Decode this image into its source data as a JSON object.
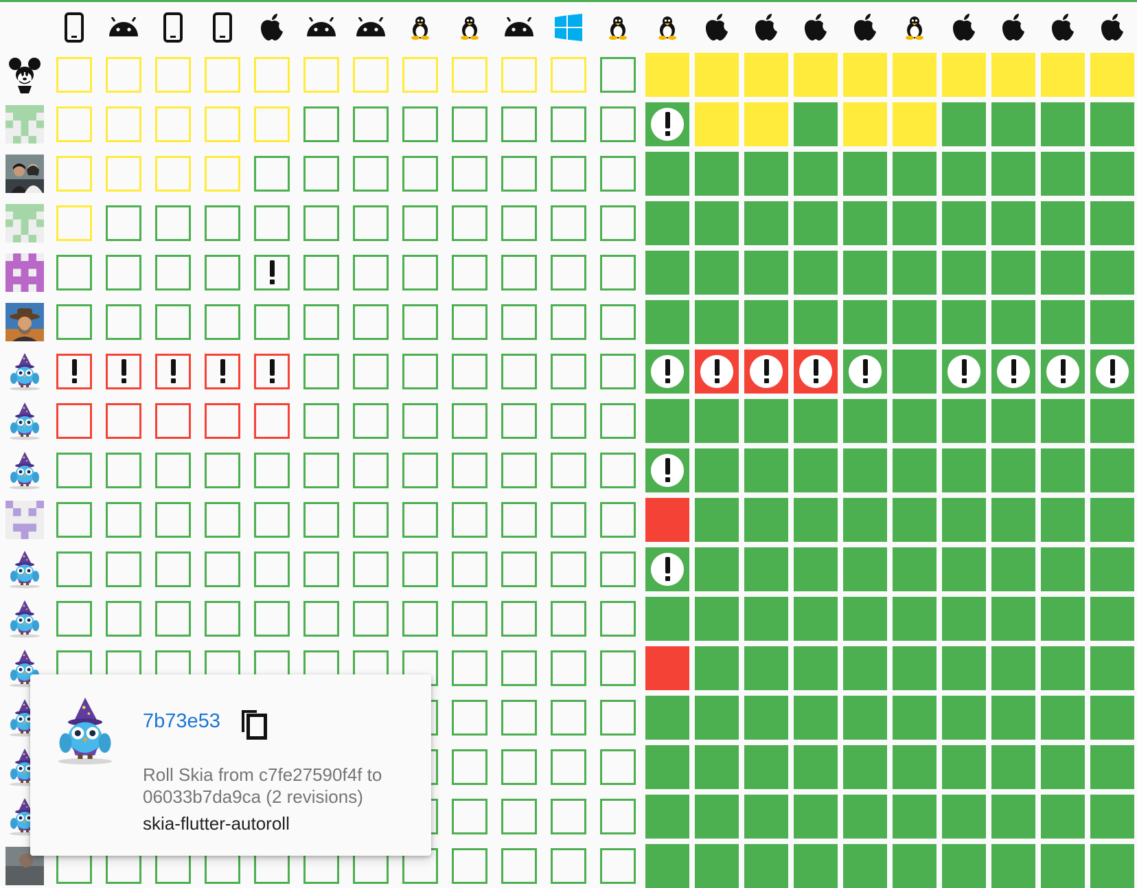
{
  "platforms": [
    "ios",
    "android",
    "ios",
    "ios",
    "mac",
    "android",
    "android",
    "linux",
    "linux",
    "android",
    "windows",
    "linux",
    "linux",
    "mac",
    "mac",
    "mac",
    "mac",
    "linux",
    "mac",
    "mac",
    "mac",
    "mac"
  ],
  "colors": {
    "yellow": "#ffeb3b",
    "green": "#4caf50",
    "red": "#f44336",
    "link": "#1976d2"
  },
  "cell_codes": {
    "Y": "outlined yellow",
    "G": "outlined green",
    "R": "outlined red",
    "E": "outlined red with exclamation",
    "W": "outlined green with exclamation",
    "F": "filled yellow",
    "Q": "filled green",
    "X": "filled red",
    "I": "filled green with exclamation",
    "J": "filled red with exclamation"
  },
  "commits": [
    {
      "avatar": "mickey-mouse-avatar",
      "cells": "YYYYYYYYYYYGFFFFFFFFFF"
    },
    {
      "avatar": "identicon-green-avatar",
      "cells": "YYYYYGGGGGGGIFFQFFQQQQ"
    },
    {
      "avatar": "photo-couple-avatar",
      "cells": "YYYYGGGGGGGGQQQQQQQQQQ"
    },
    {
      "avatar": "identicon-green-avatar",
      "cells": "YGGGGGGGGGGGQQQQQQQQQQ"
    },
    {
      "avatar": "identicon-purple-avatar",
      "cells": "GGGGWGGGGGGGQQQQQQQQQQ"
    },
    {
      "avatar": "photo-hat-avatar",
      "cells": "GGGGGGGGGGGGQQQQQQQQQQ"
    },
    {
      "avatar": "wizard-owl-avatar",
      "cells": "EEEEEGGGGGGGIJJJIQIIII"
    },
    {
      "avatar": "wizard-owl-avatar",
      "cells": "RRRRRGGGGGGGQQQQQQQQQQ"
    },
    {
      "avatar": "wizard-owl-avatar",
      "cells": "GGGGGGGGGGGGIQQQQQQQQQ"
    },
    {
      "avatar": "identicon-lavender-avatar",
      "cells": "GGGGGGGGGGGGXQQQQQQQQQ"
    },
    {
      "avatar": "wizard-owl-avatar",
      "cells": "GGGGGGGGGGGGIQQQQQQQQQ"
    },
    {
      "avatar": "wizard-owl-avatar",
      "cells": "GGGGGGGGGGGGQQQQQQQQQQ"
    },
    {
      "avatar": "wizard-owl-avatar",
      "cells": "GGGGGGGGGGGGXQQQQQQQQQ"
    },
    {
      "avatar": "wizard-owl-avatar",
      "cells": "GGGGGGGGGGGGQQQQQQQQQQ"
    },
    {
      "avatar": "wizard-owl-avatar",
      "cells": "GGGGGGGGGGGGQQQQQQQQQQ"
    },
    {
      "avatar": "wizard-owl-avatar",
      "cells": "GGGGGGGGGGGGQQQQQQQQQQ"
    },
    {
      "avatar": "photo-partial-avatar",
      "cells": "GGGGGGGGGGGGQQQQQQQQQQ"
    }
  ],
  "tooltip": {
    "sha": "7b73e53",
    "message": "Roll Skia from c7fe27590f4f to 06033b7da9ca (2 revisions)",
    "author": "skia-flutter-autoroll",
    "avatar": "wizard-owl-avatar",
    "copy_icon": "copy-icon"
  }
}
